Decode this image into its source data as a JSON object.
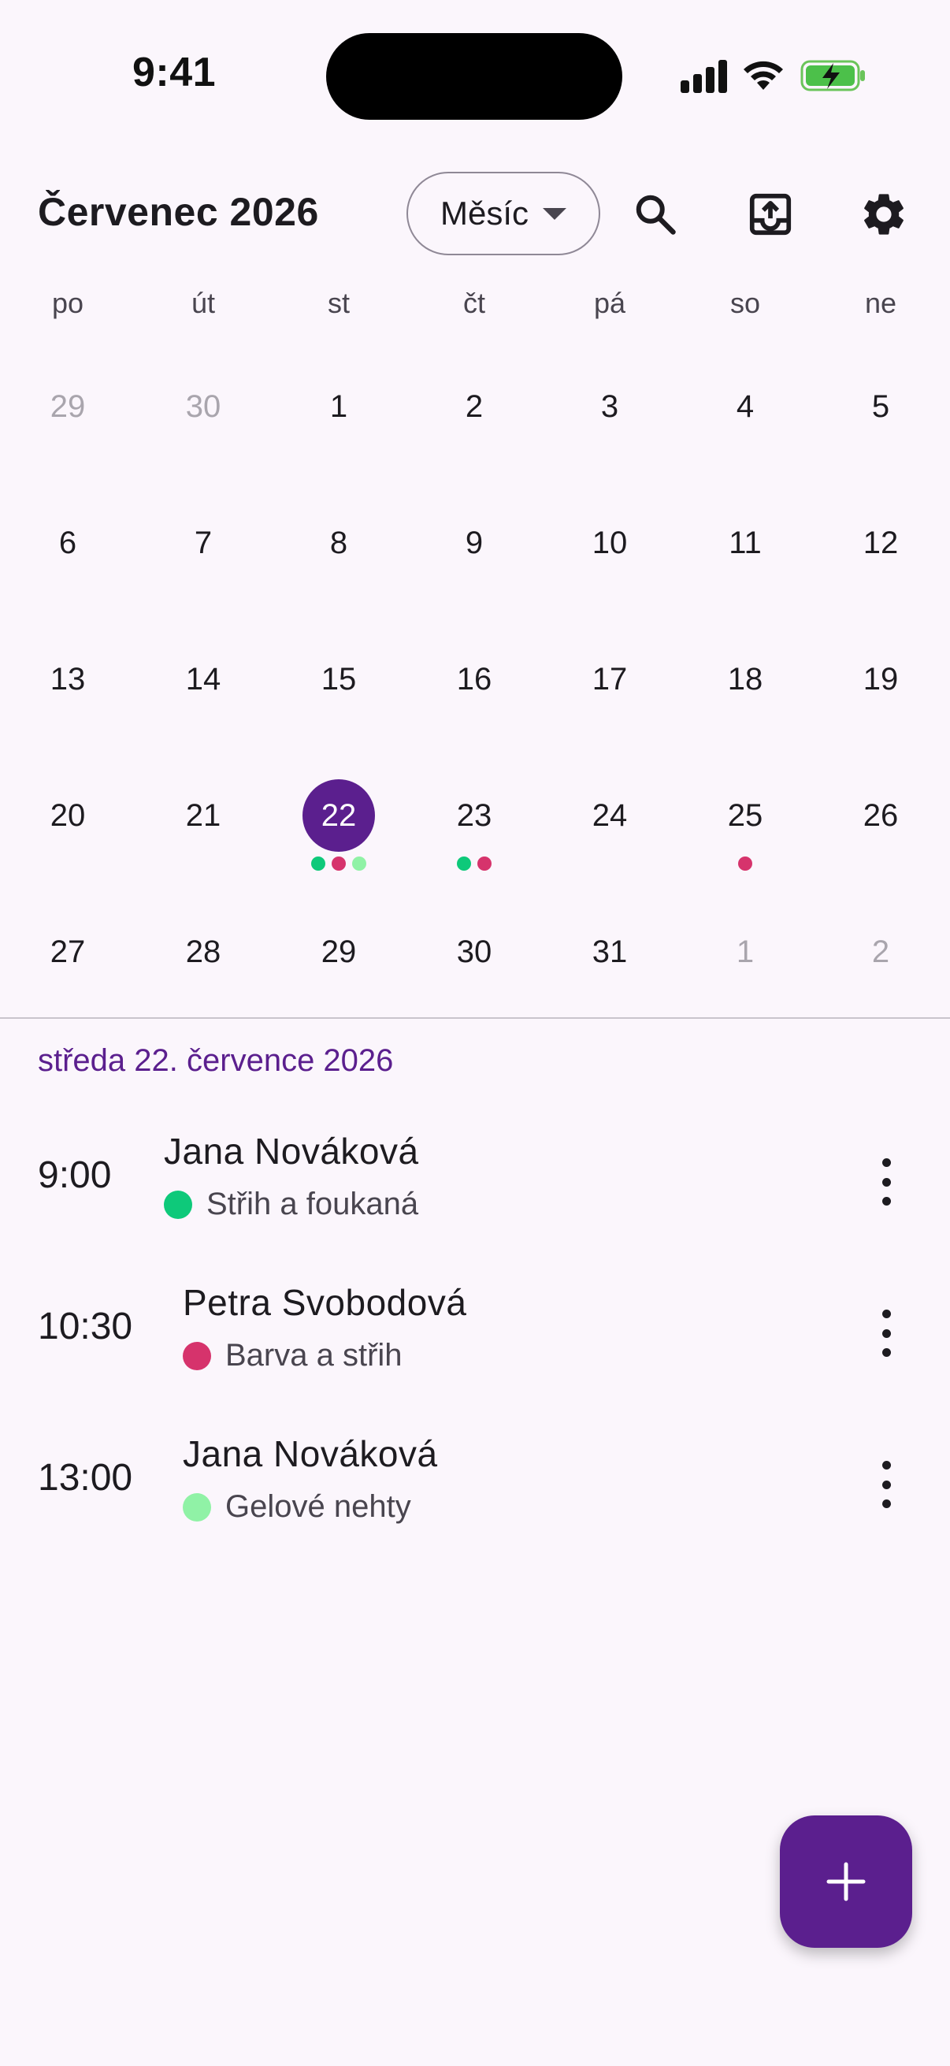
{
  "status_bar": {
    "time": "9:41"
  },
  "header": {
    "month_title": "Červenec 2026",
    "view_mode": "Měsíc"
  },
  "calendar": {
    "weekdays": [
      "po",
      "út",
      "st",
      "čt",
      "pá",
      "so",
      "ne"
    ],
    "weeks": [
      [
        {
          "day": "29",
          "other": true
        },
        {
          "day": "30",
          "other": true
        },
        {
          "day": "1"
        },
        {
          "day": "2"
        },
        {
          "day": "3"
        },
        {
          "day": "4"
        },
        {
          "day": "5"
        }
      ],
      [
        {
          "day": "6"
        },
        {
          "day": "7"
        },
        {
          "day": "8"
        },
        {
          "day": "9"
        },
        {
          "day": "10"
        },
        {
          "day": "11"
        },
        {
          "day": "12"
        }
      ],
      [
        {
          "day": "13"
        },
        {
          "day": "14"
        },
        {
          "day": "15"
        },
        {
          "day": "16"
        },
        {
          "day": "17"
        },
        {
          "day": "18"
        },
        {
          "day": "19"
        }
      ],
      [
        {
          "day": "20"
        },
        {
          "day": "21"
        },
        {
          "day": "22",
          "selected": true,
          "dots": [
            "#0ec97a",
            "#d6336c",
            "#90f2a6"
          ]
        },
        {
          "day": "23",
          "dots": [
            "#0ec97a",
            "#d6336c"
          ]
        },
        {
          "day": "24"
        },
        {
          "day": "25",
          "dots": [
            "#d6336c"
          ]
        },
        {
          "day": "26"
        }
      ],
      [
        {
          "day": "27"
        },
        {
          "day": "28"
        },
        {
          "day": "29"
        },
        {
          "day": "30"
        },
        {
          "day": "31"
        },
        {
          "day": "1",
          "other": true
        },
        {
          "day": "2",
          "other": true
        }
      ]
    ]
  },
  "agenda": {
    "date_label": "středa 22. července 2026",
    "appointments": [
      {
        "time": "9:00",
        "client": "Jana Nováková",
        "service": "Střih a foukaná",
        "color": "#0ec97a"
      },
      {
        "time": "10:30",
        "client": "Petra Svobodová",
        "service": "Barva a střih",
        "color": "#d6336c"
      },
      {
        "time": "13:00",
        "client": "Jana Nováková",
        "service": "Gelové nehty",
        "color": "#90f2a6"
      }
    ]
  },
  "colors": {
    "accent": "#5b1f8e",
    "background": "#fbf6fc"
  }
}
